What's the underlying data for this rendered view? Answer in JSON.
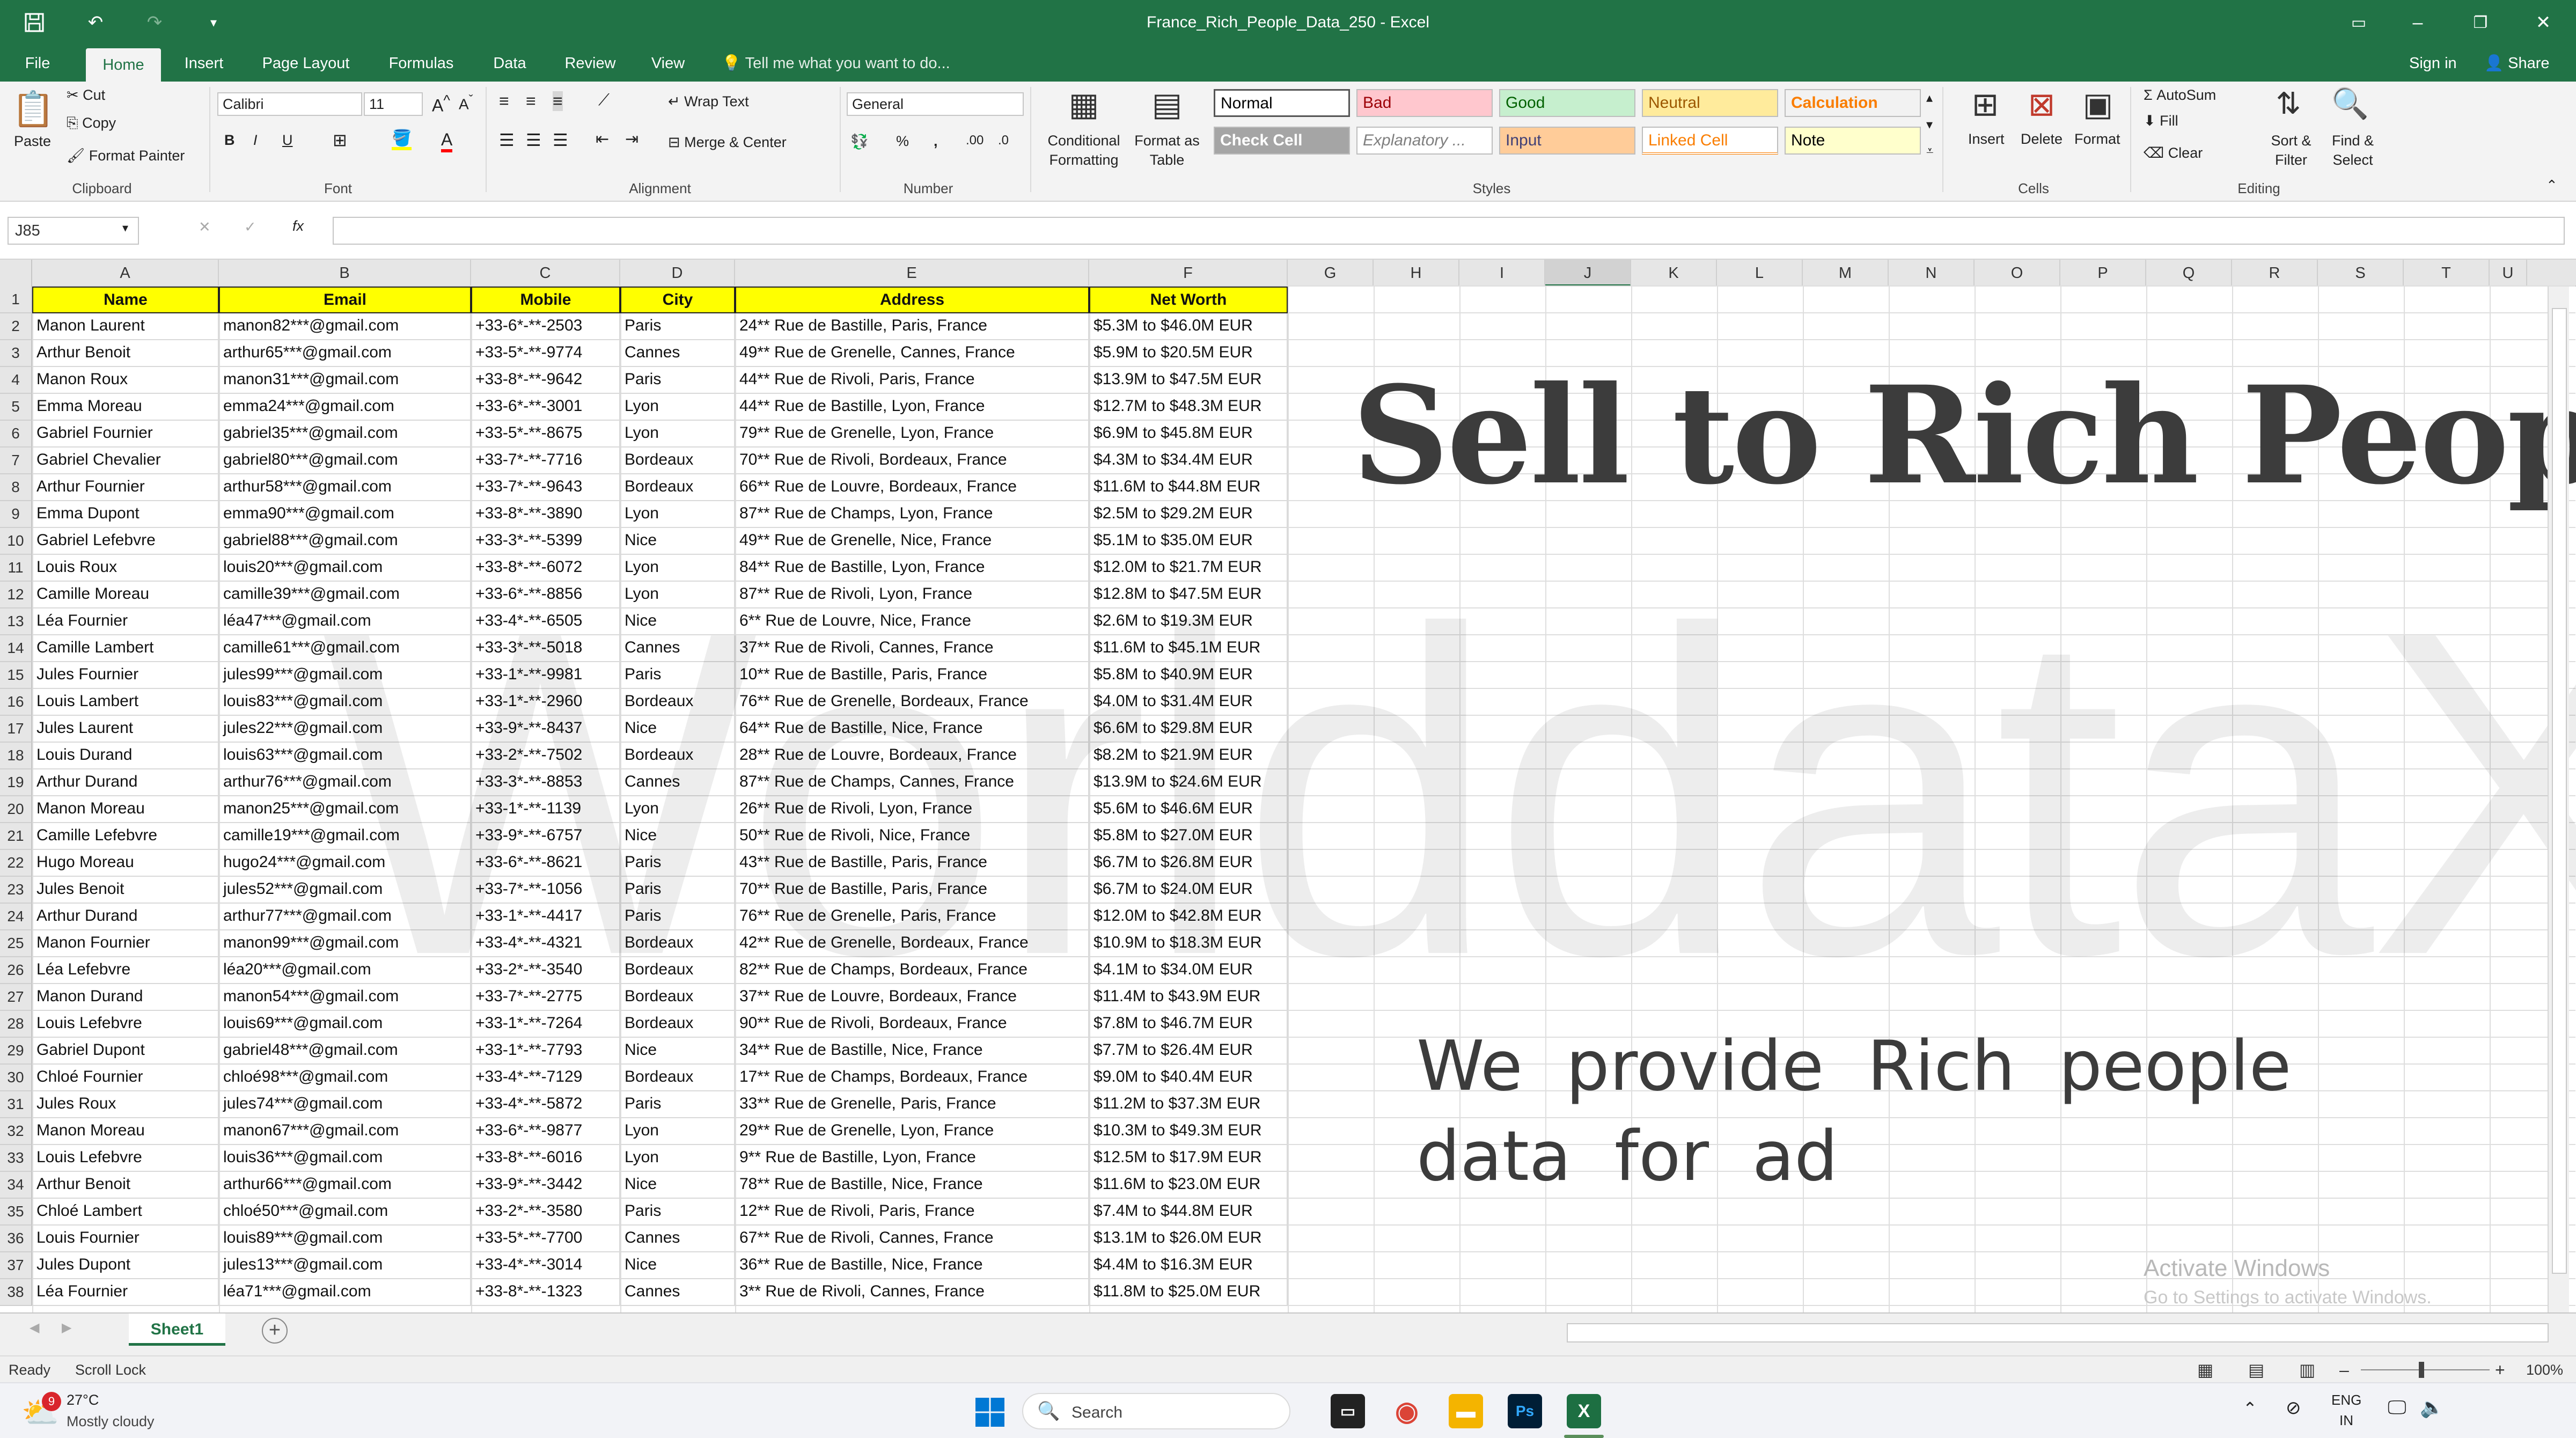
{
  "window": {
    "title": "France_Rich_People_Data_250 - Excel"
  },
  "tabs": [
    "File",
    "Home",
    "Insert",
    "Page Layout",
    "Formulas",
    "Data",
    "Review",
    "View"
  ],
  "active_tab": "Home",
  "tell_me": "Tell me what you want to do...",
  "account": {
    "sign_in": "Sign in",
    "share": "Share"
  },
  "ribbon": {
    "clipboard": {
      "label": "Clipboard",
      "paste": "Paste",
      "cut": "Cut",
      "copy": "Copy",
      "format_painter": "Format Painter"
    },
    "font": {
      "label": "Font",
      "name": "Calibri",
      "size": "11"
    },
    "alignment": {
      "label": "Alignment",
      "wrap_text": "Wrap Text",
      "merge_center": "Merge & Center"
    },
    "number": {
      "label": "Number",
      "format": "General"
    },
    "styles": {
      "label": "Styles",
      "conditional": "Conditional Formatting",
      "format_table": "Format as Table",
      "cells": [
        {
          "name": "Normal",
          "bg": "#ffffff",
          "fg": "#000000"
        },
        {
          "name": "Bad",
          "bg": "#ffc7ce",
          "fg": "#9c0006"
        },
        {
          "name": "Good",
          "bg": "#c6efce",
          "fg": "#006100"
        },
        {
          "name": "Neutral",
          "bg": "#ffeb9c",
          "fg": "#9c5700"
        },
        {
          "name": "Calculation",
          "bg": "#f2f2f2",
          "fg": "#fa7d00"
        },
        {
          "name": "Check Cell",
          "bg": "#a5a5a5",
          "fg": "#ffffff"
        },
        {
          "name": "Explanatory ...",
          "bg": "#ffffff",
          "fg": "#7f7f7f"
        },
        {
          "name": "Input",
          "bg": "#ffcc99",
          "fg": "#3f3f76"
        },
        {
          "name": "Linked Cell",
          "bg": "#ffffff",
          "fg": "#fa7d00"
        },
        {
          "name": "Note",
          "bg": "#ffffcc",
          "fg": "#000000"
        }
      ]
    },
    "cells": {
      "label": "Cells",
      "insert": "Insert",
      "delete": "Delete",
      "format": "Format"
    },
    "editing": {
      "label": "Editing",
      "autosum": "AutoSum",
      "fill": "Fill",
      "clear": "Clear",
      "sort_filter": "Sort & Filter",
      "find_select": "Find & Select"
    }
  },
  "formula_bar": {
    "name_box": "J85",
    "fx": "fx",
    "value": ""
  },
  "columns": [
    "A",
    "B",
    "C",
    "D",
    "E",
    "F",
    "G",
    "H",
    "I",
    "J",
    "K",
    "L",
    "M",
    "N",
    "O",
    "P",
    "Q",
    "R",
    "S",
    "T",
    "U"
  ],
  "headers": [
    "Name",
    "Email",
    "Mobile",
    "City",
    "Address",
    "Net Worth"
  ],
  "rows": [
    [
      "Manon Laurent",
      "manon82***@gmail.com",
      "+33-6*-**-2503",
      "Paris",
      "24** Rue de Bastille, Paris, France",
      "$5.3M to $46.0M EUR"
    ],
    [
      "Arthur Benoit",
      "arthur65***@gmail.com",
      "+33-5*-**-9774",
      "Cannes",
      "49** Rue de Grenelle, Cannes, France",
      "$5.9M to $20.5M EUR"
    ],
    [
      "Manon Roux",
      "manon31***@gmail.com",
      "+33-8*-**-9642",
      "Paris",
      "44** Rue de Rivoli, Paris, France",
      "$13.9M to $47.5M EUR"
    ],
    [
      "Emma Moreau",
      "emma24***@gmail.com",
      "+33-6*-**-3001",
      "Lyon",
      "44** Rue de Bastille, Lyon, France",
      "$12.7M to $48.3M EUR"
    ],
    [
      "Gabriel Fournier",
      "gabriel35***@gmail.com",
      "+33-5*-**-8675",
      "Lyon",
      "79** Rue de Grenelle, Lyon, France",
      "$6.9M to $45.8M EUR"
    ],
    [
      "Gabriel Chevalier",
      "gabriel80***@gmail.com",
      "+33-7*-**-7716",
      "Bordeaux",
      "70** Rue de Rivoli, Bordeaux, France",
      "$4.3M to $34.4M EUR"
    ],
    [
      "Arthur Fournier",
      "arthur58***@gmail.com",
      "+33-7*-**-9643",
      "Bordeaux",
      "66** Rue de Louvre, Bordeaux, France",
      "$11.6M to $44.8M EUR"
    ],
    [
      "Emma Dupont",
      "emma90***@gmail.com",
      "+33-8*-**-3890",
      "Lyon",
      "87** Rue de Champs, Lyon, France",
      "$2.5M to $29.2M EUR"
    ],
    [
      "Gabriel Lefebvre",
      "gabriel88***@gmail.com",
      "+33-3*-**-5399",
      "Nice",
      "49** Rue de Grenelle, Nice, France",
      "$5.1M to $35.0M EUR"
    ],
    [
      "Louis Roux",
      "louis20***@gmail.com",
      "+33-8*-**-6072",
      "Lyon",
      "84** Rue de Bastille, Lyon, France",
      "$12.0M to $21.7M EUR"
    ],
    [
      "Camille Moreau",
      "camille39***@gmail.com",
      "+33-6*-**-8856",
      "Lyon",
      "87** Rue de Rivoli, Lyon, France",
      "$12.8M to $47.5M EUR"
    ],
    [
      "Léa Fournier",
      "léa47***@gmail.com",
      "+33-4*-**-6505",
      "Nice",
      "6** Rue de Louvre, Nice, France",
      "$2.6M to $19.3M EUR"
    ],
    [
      "Camille Lambert",
      "camille61***@gmail.com",
      "+33-3*-**-5018",
      "Cannes",
      "37** Rue de Rivoli, Cannes, France",
      "$11.6M to $45.1M EUR"
    ],
    [
      "Jules Fournier",
      "jules99***@gmail.com",
      "+33-1*-**-9981",
      "Paris",
      "10** Rue de Bastille, Paris, France",
      "$5.8M to $40.9M EUR"
    ],
    [
      "Louis Lambert",
      "louis83***@gmail.com",
      "+33-1*-**-2960",
      "Bordeaux",
      "76** Rue de Grenelle, Bordeaux, France",
      "$4.0M to $31.4M EUR"
    ],
    [
      "Jules Laurent",
      "jules22***@gmail.com",
      "+33-9*-**-8437",
      "Nice",
      "64** Rue de Bastille, Nice, France",
      "$6.6M to $29.8M EUR"
    ],
    [
      "Louis Durand",
      "louis63***@gmail.com",
      "+33-2*-**-7502",
      "Bordeaux",
      "28** Rue de Louvre, Bordeaux, France",
      "$8.2M to $21.9M EUR"
    ],
    [
      "Arthur Durand",
      "arthur76***@gmail.com",
      "+33-3*-**-8853",
      "Cannes",
      "87** Rue de Champs, Cannes, France",
      "$13.9M to $24.6M EUR"
    ],
    [
      "Manon Moreau",
      "manon25***@gmail.com",
      "+33-1*-**-1139",
      "Lyon",
      "26** Rue de Rivoli, Lyon, France",
      "$5.6M to $46.6M EUR"
    ],
    [
      "Camille Lefebvre",
      "camille19***@gmail.com",
      "+33-9*-**-6757",
      "Nice",
      "50** Rue de Rivoli, Nice, France",
      "$5.8M to $27.0M EUR"
    ],
    [
      "Hugo Moreau",
      "hugo24***@gmail.com",
      "+33-6*-**-8621",
      "Paris",
      "43** Rue de Bastille, Paris, France",
      "$6.7M to $26.8M EUR"
    ],
    [
      "Jules Benoit",
      "jules52***@gmail.com",
      "+33-7*-**-1056",
      "Paris",
      "70** Rue de Bastille, Paris, France",
      "$6.7M to $24.0M EUR"
    ],
    [
      "Arthur Durand",
      "arthur77***@gmail.com",
      "+33-1*-**-4417",
      "Paris",
      "76** Rue de Grenelle, Paris, France",
      "$12.0M to $42.8M EUR"
    ],
    [
      "Manon Fournier",
      "manon99***@gmail.com",
      "+33-4*-**-4321",
      "Bordeaux",
      "42** Rue de Grenelle, Bordeaux, France",
      "$10.9M to $18.3M EUR"
    ],
    [
      "Léa Lefebvre",
      "léa20***@gmail.com",
      "+33-2*-**-3540",
      "Bordeaux",
      "82** Rue de Champs, Bordeaux, France",
      "$4.1M to $34.0M EUR"
    ],
    [
      "Manon Durand",
      "manon54***@gmail.com",
      "+33-7*-**-2775",
      "Bordeaux",
      "37** Rue de Louvre, Bordeaux, France",
      "$11.4M to $43.9M EUR"
    ],
    [
      "Louis Lefebvre",
      "louis69***@gmail.com",
      "+33-1*-**-7264",
      "Bordeaux",
      "90** Rue de Rivoli, Bordeaux, France",
      "$7.8M to $46.7M EUR"
    ],
    [
      "Gabriel Dupont",
      "gabriel48***@gmail.com",
      "+33-1*-**-7793",
      "Nice",
      "34** Rue de Bastille, Nice, France",
      "$7.7M to $26.4M EUR"
    ],
    [
      "Chloé Fournier",
      "chloé98***@gmail.com",
      "+33-4*-**-7129",
      "Bordeaux",
      "17** Rue de Champs, Bordeaux, France",
      "$9.0M to $40.4M EUR"
    ],
    [
      "Jules Roux",
      "jules74***@gmail.com",
      "+33-4*-**-5872",
      "Paris",
      "33** Rue de Grenelle, Paris, France",
      "$11.2M to $37.3M EUR"
    ],
    [
      "Manon Moreau",
      "manon67***@gmail.com",
      "+33-6*-**-9877",
      "Lyon",
      "29** Rue de Grenelle, Lyon, France",
      "$10.3M to $49.3M EUR"
    ],
    [
      "Louis Lefebvre",
      "louis36***@gmail.com",
      "+33-8*-**-6016",
      "Lyon",
      "9** Rue de Bastille, Lyon, France",
      "$12.5M to $17.9M EUR"
    ],
    [
      "Arthur Benoit",
      "arthur66***@gmail.com",
      "+33-9*-**-3442",
      "Nice",
      "78** Rue de Bastille, Nice, France",
      "$11.6M to $23.0M EUR"
    ],
    [
      "Chloé Lambert",
      "chloé50***@gmail.com",
      "+33-2*-**-3580",
      "Paris",
      "12** Rue de Rivoli, Paris, France",
      "$7.4M to $44.8M EUR"
    ],
    [
      "Louis Fournier",
      "louis89***@gmail.com",
      "+33-5*-**-7700",
      "Cannes",
      "67** Rue de Rivoli, Cannes, France",
      "$13.1M to $26.0M EUR"
    ],
    [
      "Jules Dupont",
      "jules13***@gmail.com",
      "+33-4*-**-3014",
      "Nice",
      "36** Rue de Bastille, Nice, France",
      "$4.4M to $16.3M EUR"
    ],
    [
      "Léa Fournier",
      "léa71***@gmail.com",
      "+33-8*-**-1323",
      "Cannes",
      "3** Rue de Rivoli, Cannes, France",
      "$11.8M to $25.0M EUR"
    ]
  ],
  "overlay": {
    "watermark": "WorlddataX",
    "title": "Sell to Rich People",
    "subtitle": "We provide Rich people data for ad",
    "activate_line1": "Activate Windows",
    "activate_line2": "Go to Settings to activate Windows."
  },
  "sheet_tabs": [
    "Sheet1"
  ],
  "status": {
    "ready": "Ready",
    "scroll_lock": "Scroll Lock",
    "zoom": "100%"
  },
  "taskbar": {
    "weather_temp": "27°C",
    "weather_desc": "Mostly cloudy",
    "weather_badge": "9",
    "search": "Search",
    "lang_line1": "ENG",
    "lang_line2": "IN"
  }
}
